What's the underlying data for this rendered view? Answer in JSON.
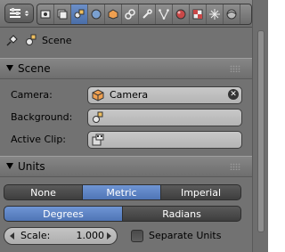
{
  "header": {
    "editor_type_icon": "properties-editor-icon",
    "tabs": [
      {
        "icon": "render-icon",
        "active": false
      },
      {
        "icon": "render-layers-icon",
        "active": false
      },
      {
        "icon": "scene-icon",
        "active": true
      },
      {
        "icon": "world-icon",
        "active": false
      },
      {
        "icon": "object-icon",
        "active": false
      },
      {
        "icon": "constraints-icon",
        "active": false
      },
      {
        "icon": "modifiers-icon",
        "active": false
      },
      {
        "icon": "data-icon",
        "active": false
      },
      {
        "icon": "material-icon",
        "active": false
      },
      {
        "icon": "texture-icon",
        "active": false
      },
      {
        "icon": "particles-icon",
        "active": false
      },
      {
        "icon": "physics-icon",
        "active": false
      }
    ]
  },
  "context": {
    "label": "Scene"
  },
  "scene_panel": {
    "title": "Scene",
    "camera_label": "Camera:",
    "camera_value": "Camera",
    "background_label": "Background:",
    "background_value": "",
    "active_clip_label": "Active Clip:",
    "active_clip_value": ""
  },
  "units_panel": {
    "title": "Units",
    "systems": [
      "None",
      "Metric",
      "Imperial"
    ],
    "selected_system": "Metric",
    "rotation": [
      "Degrees",
      "Radians"
    ],
    "selected_rotation": "Degrees",
    "scale_label": "Scale:",
    "scale_value": "1.000",
    "separate_units_label": "Separate Units",
    "separate_units_checked": false
  },
  "colors": {
    "active_blue": "#5a80c0",
    "panel_bg": "#727272",
    "field_bg": "#bebebe"
  }
}
